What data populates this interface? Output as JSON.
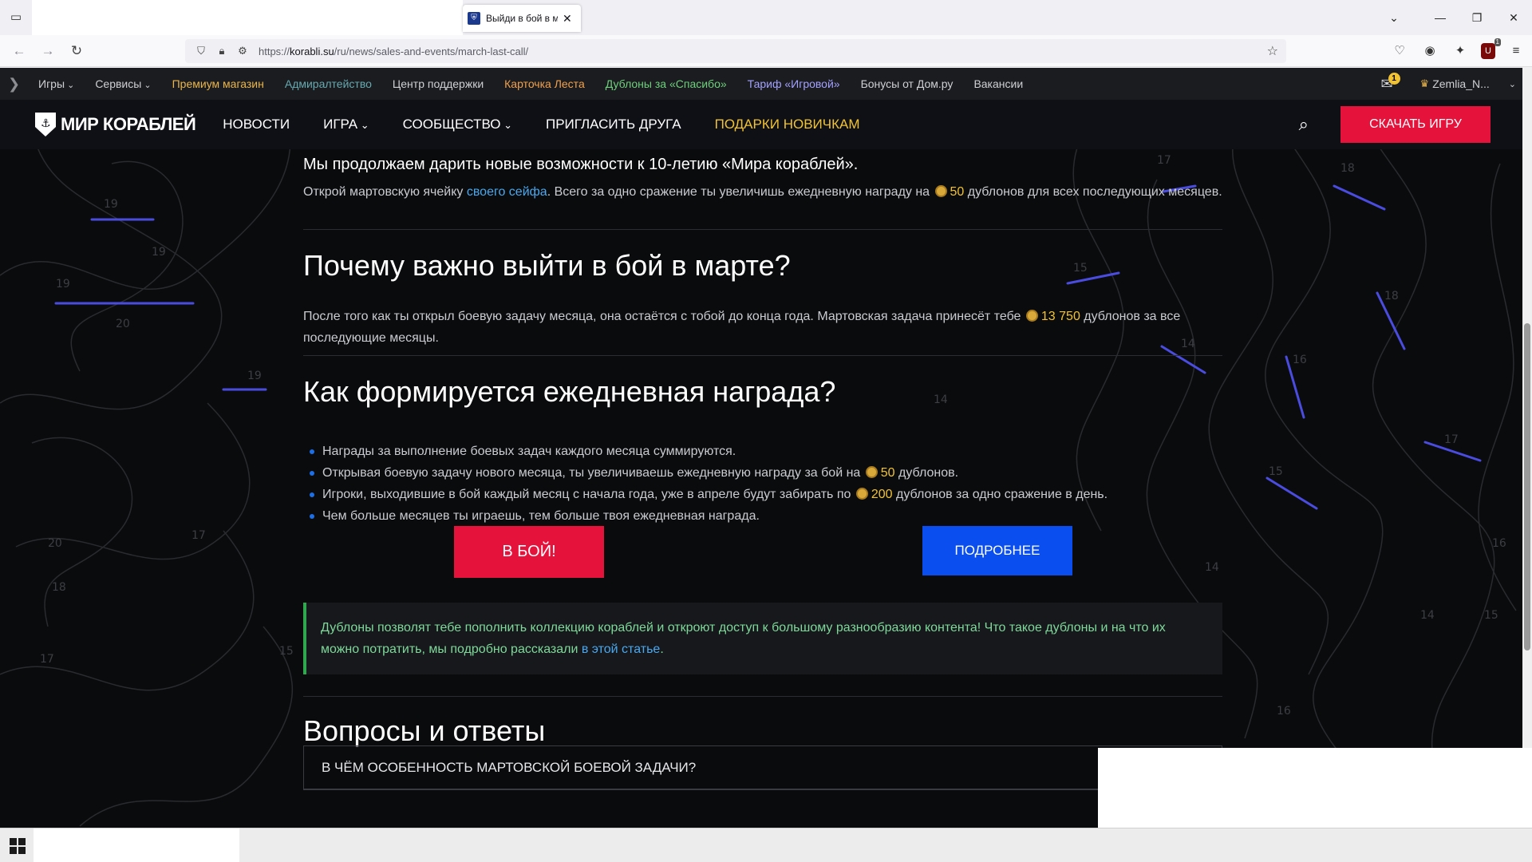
{
  "browser": {
    "tab_title": "Выйди в бой в ма",
    "tab_close": "✕",
    "url_prefix": "https://",
    "url_domain": "korabli.su",
    "url_path": "/ru/news/sales-and-events/march-last-call/",
    "icons": [
      "tab-list-icon",
      "back-icon",
      "forward-icon",
      "reload-icon",
      "shield-icon",
      "lock-icon",
      "permissions-icon",
      "star-icon",
      "pocket-icon",
      "account-icon",
      "extensions-icon",
      "ublock-icon",
      "menu-icon",
      "minimize-icon",
      "maximize-icon",
      "close-icon",
      "list-all-tabs-icon"
    ],
    "ublock_badge": "1"
  },
  "portal_bar": {
    "links": [
      {
        "label": "Игры",
        "style": "chev"
      },
      {
        "label": "Сервисы",
        "style": "chev"
      },
      {
        "label": "Премиум магазин",
        "style": "gold"
      },
      {
        "label": "Адмиралтейство",
        "style": "teal"
      },
      {
        "label": "Центр поддержки",
        "style": ""
      },
      {
        "label": "Карточка Леста",
        "style": "orange"
      },
      {
        "label": "Дублоны за «Спасибо»",
        "style": "green"
      },
      {
        "label": "Тариф «Игровой»",
        "style": "purple"
      },
      {
        "label": "Бонусы от Дом.ру",
        "style": ""
      },
      {
        "label": "Вакансии",
        "style": ""
      }
    ],
    "notification_count": "1",
    "username": "Zemlia_N..."
  },
  "header": {
    "brand": "МИР КОРАБЛЕЙ",
    "nav": [
      {
        "label": "НОВОСТИ",
        "style": ""
      },
      {
        "label": "ИГРА",
        "style": "chev"
      },
      {
        "label": "СООБЩЕСТВО",
        "style": "chev"
      },
      {
        "label": "ПРИГЛАСИТЬ ДРУГА",
        "style": ""
      },
      {
        "label": "ПОДАРКИ НОВИЧКАМ",
        "style": "gold"
      }
    ],
    "download_label": "СКАЧАТЬ ИГРУ"
  },
  "article": {
    "lead": "Мы продолжаем дарить новые возможности к 10-летию «Мира кораблей».",
    "p1_before": "Открой мартовскую ячейку ",
    "p1_link": "своего сейфа",
    "p1_mid": ". Всего за одно сражение ты увеличишь ежедневную награду на ",
    "p1_amount": "50",
    "p1_after": " дублонов для всех последующих месяцев.",
    "h2_why": "Почему важно выйти в бой в марте?",
    "p2_before": "После того как ты открыл боевую задачу месяца, она остаётся с тобой до конца года. Мартовская задача принесёт тебе ",
    "p2_amount": "13 750",
    "p2_after": " дублонов за все последующие месяцы.",
    "h2_how": "Как формируется ежедневная награда?",
    "bullets": {
      "b1": "Награды за выполнение боевых задач каждого месяца суммируются.",
      "b2_before": "Открывая боевую задачу нового месяца, ты увеличиваешь ежедневную награду за бой на ",
      "b2_amount": "50",
      "b2_after": " дублонов.",
      "b3_before": "Игроки, выходившие в бой каждый месяц с начала года, уже в апреле будут забирать по ",
      "b3_amount": "200",
      "b3_after": " дублонов за одно сражение в день.",
      "b4": "Чем больше месяцев ты играешь, тем больше твоя ежедневная награда."
    },
    "battle_button": "В БОЙ!",
    "more_button": "ПОДРОБНЕЕ",
    "note_before": "Дублоны позволят тебе пополнить коллекцию кораблей и откроют доступ к большому разнообразию контента! Что такое дублоны и на что их можно потратить, мы подробно рассказали ",
    "note_link": "в этой статье",
    "note_after": ".",
    "h2_faq": "Вопросы и ответы",
    "faq_1": "В ЧЁМ ОСОБЕННОСТЬ МАРТОВСКОЙ БОЕВОЙ ЗАДАЧИ?"
  },
  "colors": {
    "accent_red": "#e5133b",
    "accent_blue": "#0b4eef",
    "gold": "#f1c232",
    "link": "#4aa8ee",
    "note_green": "#2fa84f"
  }
}
